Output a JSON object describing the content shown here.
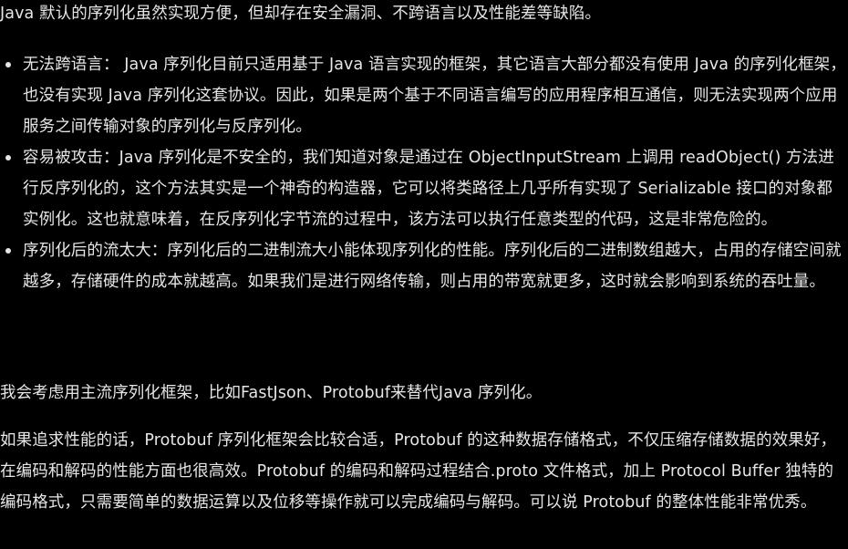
{
  "intro": "Java 默认的序列化虽然实现方便，但却存在安全漏洞、不跨语言以及性能差等缺陷。",
  "bullets": [
    {
      "label": "无法跨语言：",
      "text": " Java 序列化目前只适用基于 Java 语言实现的框架，其它语言大部分都没有使用 Java 的序列化框架，也没有实现 Java 序列化这套协议。因此，如果是两个基于不同语言编写的应用程序相互通信，则无法实现两个应用服务之间传输对象的序列化与反序列化。"
    },
    {
      "label": "容易被攻击：",
      "text": "Java 序列化是不安全的，我们知道对象是通过在 ObjectInputStream 上调用 readObject() 方法进行反序列化的，这个方法其实是一个神奇的构造器，它可以将类路径上几乎所有实现了 Serializable 接口的对象都实例化。这也就意味着，在反序列化字节流的过程中，该方法可以执行任意类型的代码，这是非常危险的。"
    },
    {
      "label": "序列化后的流太大：",
      "text": "序列化后的二进制流大小能体现序列化的性能。序列化后的二进制数组越大，占用的存储空间就越多，存储硬件的成本就越高。如果我们是进行网络传输，则占用的带宽就更多，这时就会影响到系统的吞吐量。"
    }
  ],
  "choice": "我会考虑用主流序列化框架，比如FastJson、Protobuf来替代Java 序列化。",
  "protobuf": "如果追求性能的话，Protobuf 序列化框架会比较合适，Protobuf 的这种数据存储格式，不仅压缩存储数据的效果好， 在编码和解码的性能方面也很高效。Protobuf 的编码和解码过程结合.proto 文件格式，加上 Protocol Buffer 独特的编码格式，只需要简单的数据运算以及位移等操作就可以完成编码与解码。可以说 Protobuf 的整体性能非常优秀。",
  "colors": {
    "background": "#000000",
    "text": "#e6e6e6"
  }
}
